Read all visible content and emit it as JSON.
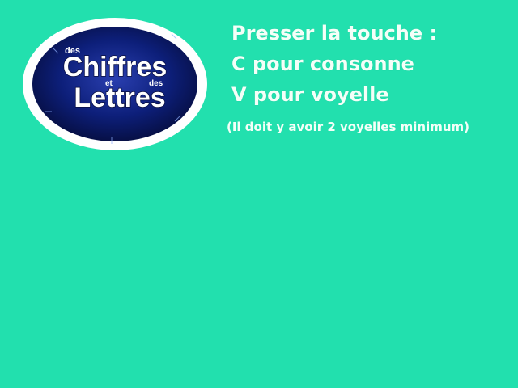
{
  "logo": {
    "word_des_top": "des",
    "word_chiffres": "Chiffres",
    "word_et": "et",
    "word_des_mid": "des",
    "word_lettres": "Lettres"
  },
  "instructions": {
    "line1": "Presser la touche :",
    "line2": "C pour consonne",
    "line3": "V pour voyelle",
    "note": "(Il doit y avoir 2 voyelles minimum)"
  },
  "colors": {
    "background": "#22e0ae",
    "text": "#f4fff8",
    "logo_ring": "#ffffff",
    "logo_disc": "#0a1a6e"
  }
}
